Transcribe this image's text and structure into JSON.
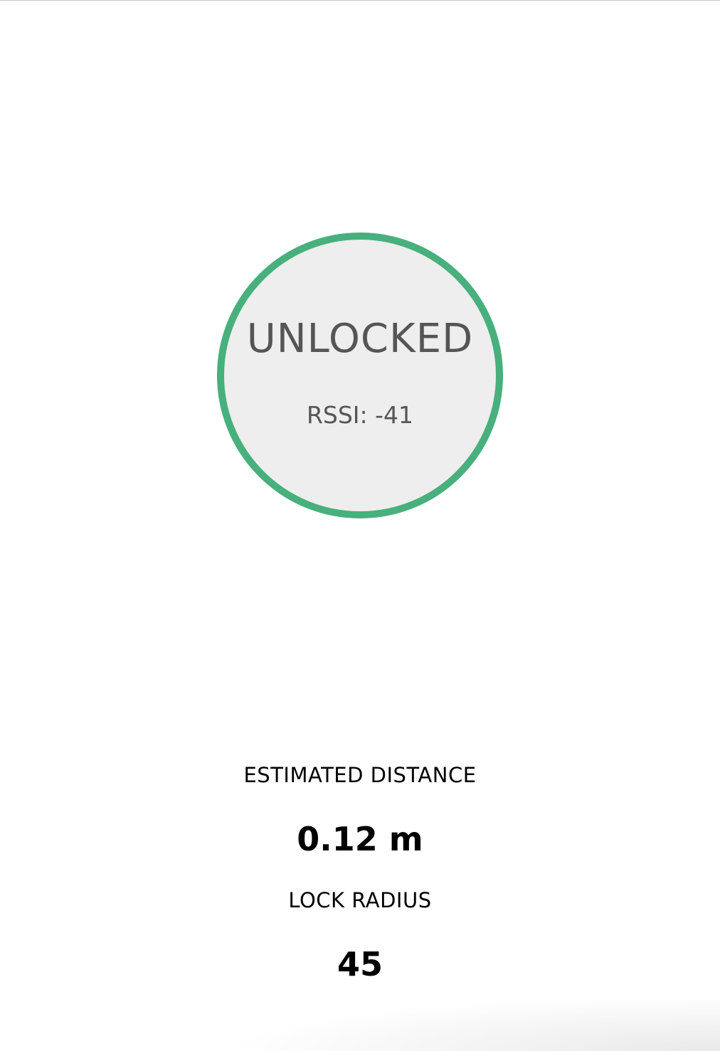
{
  "status": {
    "label": "UNLOCKED",
    "rssi": "RSSI: -41",
    "ring_color": "#47b07c"
  },
  "distance": {
    "label": "ESTIMATED DISTANCE",
    "value": "0.12 m"
  },
  "lock_radius": {
    "label": "LOCK RADIUS",
    "value": "45"
  }
}
